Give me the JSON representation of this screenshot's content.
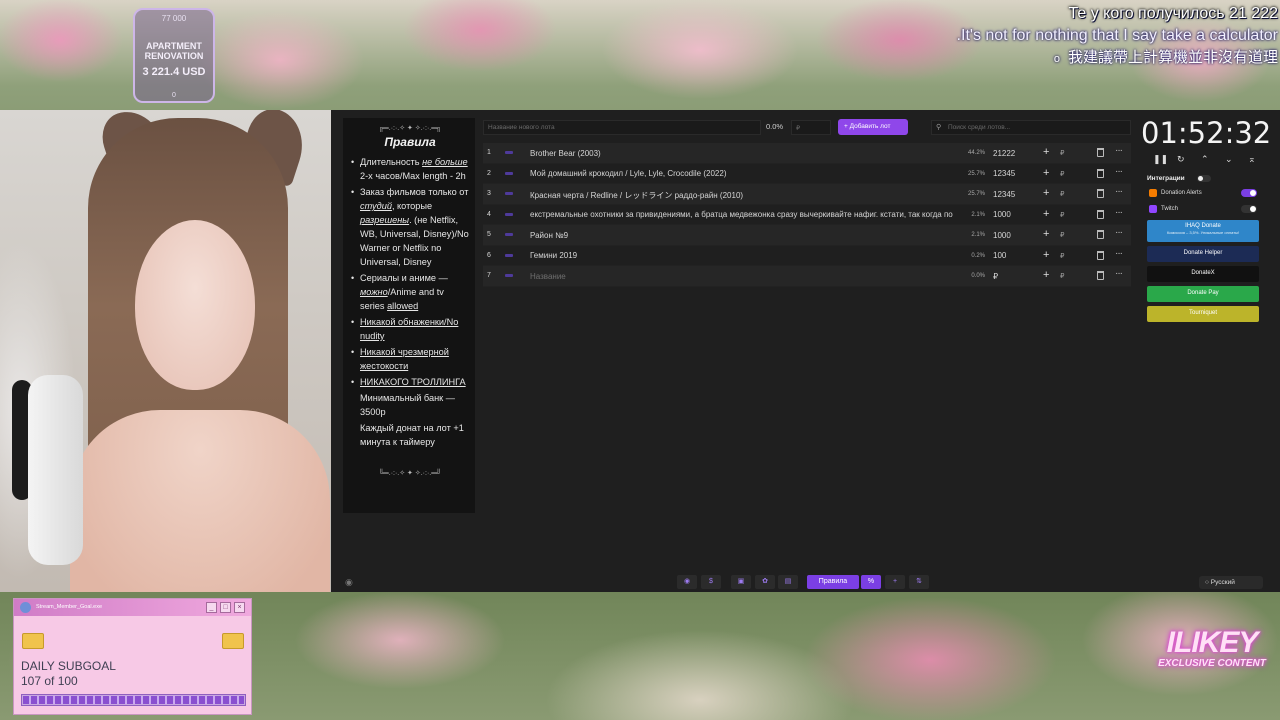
{
  "overlay": {
    "goal": {
      "target": "77 000",
      "name": "APARTMENT RENOVATION",
      "amount": "3 221.4 USD",
      "start": "0"
    },
    "subtitles": {
      "line1": "Те у кого получилось 21 222",
      "line2": ".It's not for nothing that I say take a calculator",
      "line3": "我建議帶上計算機並非沒有道理",
      "line3_dot": "o"
    },
    "subgoal": {
      "window_title": "Stream_Member_Goal.exe",
      "label": "DAILY SUBGOAL",
      "progress_text": "107 of 100",
      "progress": 1.0
    },
    "logo": {
      "big": "ILIKEY",
      "small": "EXCLUSIVE CONTENT"
    }
  },
  "rules": {
    "deco_top": "╔═.·:·.✧ ✦ ✧.·:·.═╗",
    "title": "Правила",
    "items": [
      {
        "pre": "Длительность ",
        "em": "не больше",
        "post": " 2-х часов/Max length - 2h"
      },
      {
        "pre": "Заказ фильмов только от ",
        "em": "студий",
        "mid": ", которые ",
        "em2": "разрешены",
        "post": ". (не Netflix, WB, Universal, Disney)/No Warner or Netflix no Universal, Disney"
      },
      {
        "pre": "Сериалы и аниме — ",
        "em": "можно",
        "post": "/Anime and tv series ",
        "u": "allowed"
      },
      {
        "u": "Никакой обнаженки/No nudity"
      },
      {
        "u": "Никакой чрезмерной жестокости"
      },
      {
        "u": "НИКАКОГО ТРОЛЛИНГА"
      },
      {
        "plain": "Минимальный банк — 3500р",
        "nobullet": true
      },
      {
        "plain": "Каждый донат на лот +1 минута к таймеру",
        "nobullet": true
      }
    ],
    "deco_bottom": "╚═.·:·.✧ ✦ ✧.·:·.═╝"
  },
  "toolbar": {
    "lot_name_placeholder": "Название нового лота",
    "percent": "0.0%",
    "amount_placeholder": "₽",
    "add_button": "+ Добавить лот",
    "search_placeholder": "Поиск среди лотов..."
  },
  "lots": [
    {
      "num": "1",
      "title": "Brother Bear (2003)",
      "percent": "44.2%",
      "amount": "21222"
    },
    {
      "num": "2",
      "title": "Мой домашний крокодил / Lyle, Lyle, Crocodile (2022)",
      "percent": "25.7%",
      "amount": "12345"
    },
    {
      "num": "3",
      "title": "Красная черта / Redline / レッドライン раддо-райн (2010)",
      "percent": "25.7%",
      "amount": "12345"
    },
    {
      "num": "4",
      "title": "екстремальные охотники за привидениями, а братца медвежонка сразу вычеркивайте нафиг. кстати, так когда по",
      "percent": "2.1%",
      "amount": "1000"
    },
    {
      "num": "5",
      "title": "Район №9",
      "percent": "2.1%",
      "amount": "1000"
    },
    {
      "num": "6",
      "title": "Гемини 2019",
      "percent": "0.2%",
      "amount": "100"
    },
    {
      "num": "7",
      "title": "Название",
      "percent": "0.0%",
      "amount": "₽",
      "empty": true
    }
  ],
  "lot_row_currency": "₽",
  "timer": {
    "value": "01:52:32"
  },
  "integrations": {
    "header": "Интеграции",
    "toggles": [
      {
        "name": "Donation Alerts",
        "on": true,
        "color": "#f57c00"
      },
      {
        "name": "Twitch",
        "on": false,
        "color": "#9146ff"
      }
    ],
    "cards": [
      {
        "name": "IHAQ Donate",
        "sub": "Комиссия – 3,5%. Уникальные оплаты!",
        "color": "#2f86c9"
      },
      {
        "name": "Donate Helper",
        "color": "#1c2b55"
      },
      {
        "name": "DonateX",
        "color": "#111111"
      },
      {
        "name": "Donate Pay",
        "color": "#2aa84a"
      },
      {
        "name": "Tourniquet",
        "color": "#bcb42a"
      }
    ]
  },
  "bottom": {
    "rules_tab": "Правила",
    "language": "Русский"
  }
}
